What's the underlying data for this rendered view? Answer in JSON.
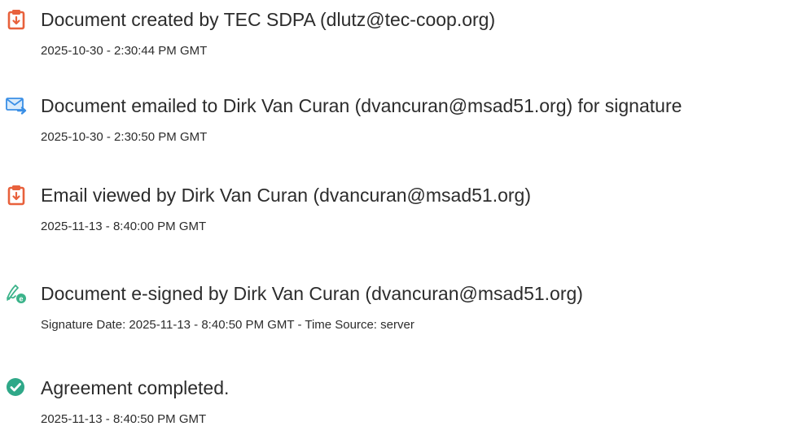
{
  "colors": {
    "doc_icon": "#e8613c",
    "email_icon": "#3a8fe6",
    "sign_icon": "#3bb38a",
    "complete_icon": "#2fa888",
    "text": "#2c2c2c"
  },
  "events": [
    {
      "icon": "document-icon",
      "title": "Document created by TEC SDPA (dlutz@tec-coop.org)",
      "detail": "2025-10-30 - 2:30:44 PM GMT"
    },
    {
      "icon": "email-sent-icon",
      "title": "Document emailed to Dirk Van Curan (dvancuran@msad51.org) for signature",
      "detail": "2025-10-30 - 2:30:50 PM GMT"
    },
    {
      "icon": "document-icon",
      "title": "Email viewed by Dirk Van Curan (dvancuran@msad51.org)",
      "detail": "2025-11-13 - 8:40:00 PM GMT"
    },
    {
      "icon": "e-sign-pen-icon",
      "title": "Document e-signed by Dirk Van Curan (dvancuran@msad51.org)",
      "detail": "Signature Date: 2025-11-13 - 8:40:50 PM GMT - Time Source: server"
    },
    {
      "icon": "check-circle-icon",
      "title": "Agreement completed.",
      "detail": "2025-11-13 - 8:40:50 PM GMT"
    }
  ]
}
